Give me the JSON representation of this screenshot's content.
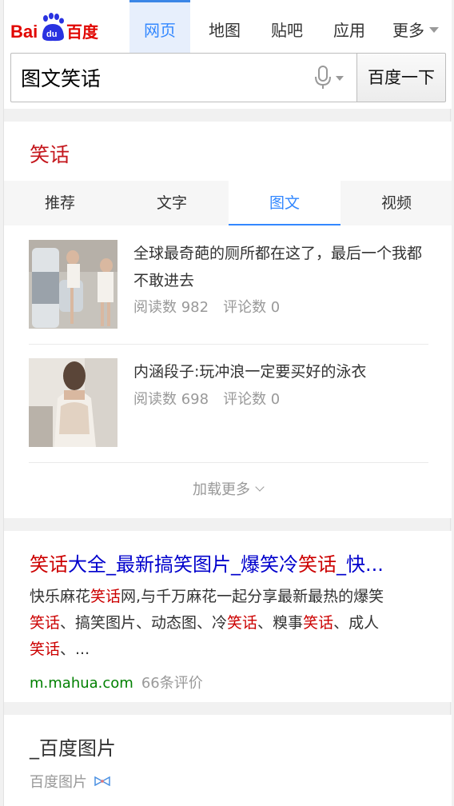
{
  "header": {
    "logo": {
      "bai": "Bai",
      "du": "du",
      "cn": "百度"
    },
    "nav": [
      {
        "label": "网页",
        "active": true
      },
      {
        "label": "地图",
        "active": false
      },
      {
        "label": "贴吧",
        "active": false
      },
      {
        "label": "应用",
        "active": false
      },
      {
        "label": "更多",
        "active": false
      }
    ],
    "search": {
      "value": "图文笑话",
      "button": "百度一下"
    }
  },
  "card1": {
    "title": "笑话",
    "tabs": [
      {
        "label": "推荐",
        "active": false
      },
      {
        "label": "文字",
        "active": false
      },
      {
        "label": "图文",
        "active": true
      },
      {
        "label": "视频",
        "active": false
      }
    ],
    "items": [
      {
        "title": "全球最奇葩的厕所都在这了，最后一个我都不敢进去",
        "reads": "阅读数 982",
        "comments": "评论数 0"
      },
      {
        "title": "内涵段子:玩冲浪一定要买好的泳衣",
        "reads": "阅读数 698",
        "comments": "评论数 0"
      }
    ],
    "more": "加载更多"
  },
  "result": {
    "title_parts": [
      "笑话",
      "大全_最新搞笑图片_爆笑冷",
      "笑话",
      "_快..."
    ],
    "abstract": [
      "快乐麻花",
      "笑话",
      "网,与千万麻花一起分享最新最热的爆笑",
      "笑话",
      "、搞笑图片、动态图、冷",
      "笑话",
      "、糗事",
      "笑话",
      "、成人",
      "笑话",
      "、..."
    ],
    "url": "m.mahua.com",
    "rating": "66条评价"
  },
  "card3": {
    "title": "_百度图片",
    "source": "百度图片"
  },
  "colors": {
    "brand_red": "#e10601",
    "brand_blue": "#2932e1",
    "link_blue": "#0000cc",
    "highlight": "#cc0000",
    "url_green": "#008000",
    "tab_blue": "#3388ff"
  }
}
